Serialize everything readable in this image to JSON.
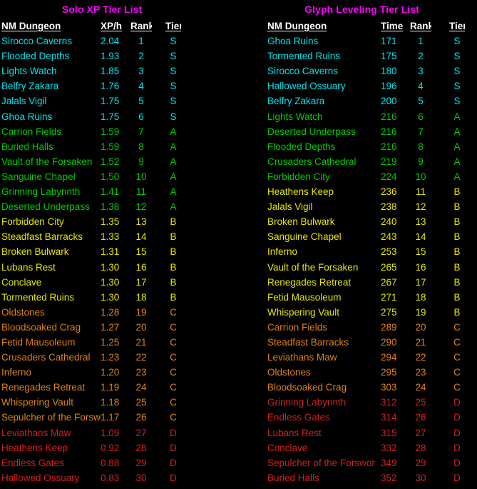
{
  "tier_colors": {
    "S": "#00E5EE",
    "A": "#00CC00",
    "B": "#E6E600",
    "C": "#E08214",
    "D": "#D42020",
    "title": "#FF00FF",
    "header": "#FFFFFF",
    "background": "#000000"
  },
  "panels": [
    {
      "id": "solo-xp",
      "title": "Solo XP Tier List",
      "columns": [
        "NM Dungeon",
        "XP/h",
        "Rank",
        "Tier"
      ],
      "rows": [
        {
          "name": "Sirocco Caverns",
          "metric": "2.04",
          "rank": "1",
          "tier": "S"
        },
        {
          "name": "Flooded Depths",
          "metric": "1.93",
          "rank": "2",
          "tier": "S"
        },
        {
          "name": "Lights Watch",
          "metric": "1.85",
          "rank": "3",
          "tier": "S"
        },
        {
          "name": "Belfry Zakara",
          "metric": "1.76",
          "rank": "4",
          "tier": "S"
        },
        {
          "name": "Jalals Vigil",
          "metric": "1.75",
          "rank": "5",
          "tier": "S"
        },
        {
          "name": "Ghoa Ruins",
          "metric": "1.75",
          "rank": "6",
          "tier": "S"
        },
        {
          "name": "Carrion Fields",
          "metric": "1.59",
          "rank": "7",
          "tier": "A"
        },
        {
          "name": "Buried Halls",
          "metric": "1.59",
          "rank": "8",
          "tier": "A"
        },
        {
          "name": "Vault of the Forsaken",
          "metric": "1.52",
          "rank": "9",
          "tier": "A"
        },
        {
          "name": "Sanguine Chapel",
          "metric": "1.50",
          "rank": "10",
          "tier": "A"
        },
        {
          "name": "Grinning Labyrinth",
          "metric": "1.41",
          "rank": "11",
          "tier": "A"
        },
        {
          "name": "Deserted Underpass",
          "metric": "1.38",
          "rank": "12",
          "tier": "A"
        },
        {
          "name": "Forbidden City",
          "metric": "1.35",
          "rank": "13",
          "tier": "B"
        },
        {
          "name": "Steadfast Barracks",
          "metric": "1.33",
          "rank": "14",
          "tier": "B"
        },
        {
          "name": "Broken Bulwark",
          "metric": "1.31",
          "rank": "15",
          "tier": "B"
        },
        {
          "name": "Lubans Rest",
          "metric": "1.30",
          "rank": "16",
          "tier": "B"
        },
        {
          "name": "Conclave",
          "metric": "1.30",
          "rank": "17",
          "tier": "B"
        },
        {
          "name": "Tormented Ruins",
          "metric": "1.30",
          "rank": "18",
          "tier": "B"
        },
        {
          "name": "Oldstones",
          "metric": "1.28",
          "rank": "19",
          "tier": "C"
        },
        {
          "name": "Bloodsoaked Crag",
          "metric": "1.27",
          "rank": "20",
          "tier": "C"
        },
        {
          "name": "Fetid Mausoleum",
          "metric": "1.25",
          "rank": "21",
          "tier": "C"
        },
        {
          "name": "Crusaders Cathedral",
          "metric": "1.23",
          "rank": "22",
          "tier": "C"
        },
        {
          "name": "Inferno",
          "metric": "1.20",
          "rank": "23",
          "tier": "C"
        },
        {
          "name": "Renegades Retreat",
          "metric": "1.19",
          "rank": "24",
          "tier": "C"
        },
        {
          "name": "Whispering Vault",
          "metric": "1.18",
          "rank": "25",
          "tier": "C"
        },
        {
          "name": "Sepulcher of the Forsworn",
          "metric": "1.17",
          "rank": "26",
          "tier": "C"
        },
        {
          "name": "Leviathans Maw",
          "metric": "1.09",
          "rank": "27",
          "tier": "D"
        },
        {
          "name": "Heathens Keep",
          "metric": "0.92",
          "rank": "28",
          "tier": "D"
        },
        {
          "name": "Endless Gates",
          "metric": "0.88",
          "rank": "29",
          "tier": "D"
        },
        {
          "name": "Hallowed Ossuary",
          "metric": "0.83",
          "rank": "30",
          "tier": "D"
        }
      ]
    },
    {
      "id": "glyph-leveling",
      "title": "Glyph Leveling Tier List",
      "columns": [
        "NM Dungeon",
        "Time",
        "Rank",
        "Tier"
      ],
      "rows": [
        {
          "name": "Ghoa Ruins",
          "metric": "171",
          "rank": "1",
          "tier": "S"
        },
        {
          "name": "Tormented Ruins",
          "metric": "175",
          "rank": "2",
          "tier": "S"
        },
        {
          "name": "Sirocco Caverns",
          "metric": "180",
          "rank": "3",
          "tier": "S"
        },
        {
          "name": "Hallowed Ossuary",
          "metric": "196",
          "rank": "4",
          "tier": "S"
        },
        {
          "name": "Belfry Zakara",
          "metric": "200",
          "rank": "5",
          "tier": "S"
        },
        {
          "name": "Lights Watch",
          "metric": "216",
          "rank": "6",
          "tier": "A"
        },
        {
          "name": "Deserted Underpass",
          "metric": "216",
          "rank": "7",
          "tier": "A"
        },
        {
          "name": "Flooded Depths",
          "metric": "216",
          "rank": "8",
          "tier": "A"
        },
        {
          "name": "Crusaders Cathedral",
          "metric": "219",
          "rank": "9",
          "tier": "A"
        },
        {
          "name": "Forbidden City",
          "metric": "224",
          "rank": "10",
          "tier": "A"
        },
        {
          "name": "Heathens Keep",
          "metric": "236",
          "rank": "11",
          "tier": "B"
        },
        {
          "name": "Jalals Vigil",
          "metric": "238",
          "rank": "12",
          "tier": "B"
        },
        {
          "name": "Broken Bulwark",
          "metric": "240",
          "rank": "13",
          "tier": "B"
        },
        {
          "name": "Sanguine Chapel",
          "metric": "243",
          "rank": "14",
          "tier": "B"
        },
        {
          "name": "Inferno",
          "metric": "253",
          "rank": "15",
          "tier": "B"
        },
        {
          "name": "Vault of the Forsaken",
          "metric": "265",
          "rank": "16",
          "tier": "B"
        },
        {
          "name": "Renegades Retreat",
          "metric": "267",
          "rank": "17",
          "tier": "B"
        },
        {
          "name": "Fetid Mausoleum",
          "metric": "271",
          "rank": "18",
          "tier": "B"
        },
        {
          "name": "Whispering Vault",
          "metric": "275",
          "rank": "19",
          "tier": "B"
        },
        {
          "name": "Carrion Fields",
          "metric": "289",
          "rank": "20",
          "tier": "C"
        },
        {
          "name": "Steadfast Barracks",
          "metric": "290",
          "rank": "21",
          "tier": "C"
        },
        {
          "name": "Leviathans Maw",
          "metric": "294",
          "rank": "22",
          "tier": "C"
        },
        {
          "name": "Oldstones",
          "metric": "295",
          "rank": "23",
          "tier": "C"
        },
        {
          "name": "Bloodsoaked Crag",
          "metric": "303",
          "rank": "24",
          "tier": "C"
        },
        {
          "name": "Grinning Labyrinth",
          "metric": "312",
          "rank": "25",
          "tier": "D"
        },
        {
          "name": "Endless Gates",
          "metric": "314",
          "rank": "26",
          "tier": "D"
        },
        {
          "name": "Lubans Rest",
          "metric": "315",
          "rank": "27",
          "tier": "D"
        },
        {
          "name": "Conclave",
          "metric": "332",
          "rank": "28",
          "tier": "D"
        },
        {
          "name": "Sepulcher of the Forsworn",
          "metric": "349",
          "rank": "29",
          "tier": "D"
        },
        {
          "name": "Buried Halls",
          "metric": "352",
          "rank": "30",
          "tier": "D"
        }
      ]
    }
  ]
}
